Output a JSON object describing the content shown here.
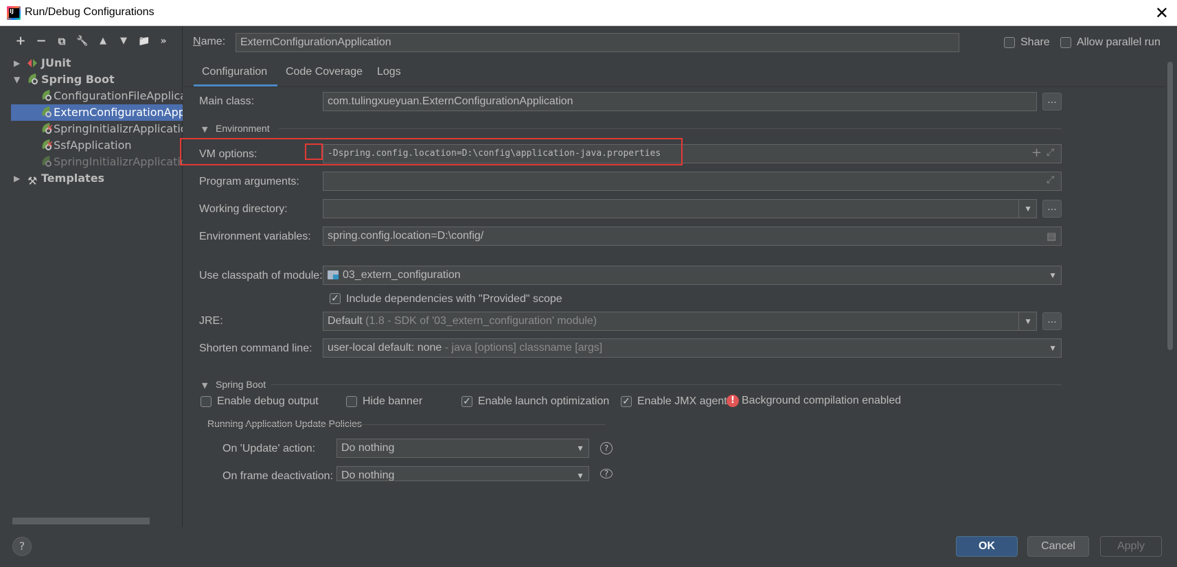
{
  "window": {
    "title": "Run/Debug Configurations"
  },
  "toolbar": {
    "add": "+",
    "remove": "−",
    "copy": "⧉",
    "edit": "🔧",
    "up": "▲",
    "down": "▼",
    "folder": "📁",
    "more": "»"
  },
  "tree": {
    "junit": "JUnit",
    "spring_boot": "Spring Boot",
    "items": [
      "ConfigurationFileApplica",
      "ExternConfigurationAppl",
      "SpringInitializrApplicatio",
      "SsfApplication",
      "SpringInitializrApplicatio"
    ],
    "templates": "Templates"
  },
  "header": {
    "name_label": "Name:",
    "name_value": "ExternConfigurationApplication",
    "share_label": "Share",
    "parallel_label": "Allow parallel run"
  },
  "tabs": [
    "Configuration",
    "Code Coverage",
    "Logs"
  ],
  "form": {
    "main_class_label": "Main class:",
    "main_class_value": "com.tulingxueyuan.ExternConfigurationApplication",
    "environment_section": "Environment",
    "vm_options_label": "VM options:",
    "vm_options_value": "-Dspring.config.location=D:\\config\\application-java.properties",
    "program_args_label": "Program arguments:",
    "working_dir_label": "Working directory:",
    "env_vars_label": "Environment variables:",
    "env_vars_value": "spring.config.location=D:\\config/",
    "classpath_label": "Use classpath of module:",
    "classpath_value": "03_extern_configuration",
    "include_deps_label": "Include dependencies with \"Provided\" scope",
    "jre_label": "JRE:",
    "jre_value_main": "Default",
    "jre_value_detail": "(1.8 - SDK of '03_extern_configuration' module)",
    "shorten_label": "Shorten command line:",
    "shorten_value_main": "user-local default: none",
    "shorten_value_detail": "- java [options] classname [args]",
    "dots": "..."
  },
  "spring_boot": {
    "section": "Spring Boot",
    "debug_output": "Enable debug output",
    "hide_banner": "Hide banner",
    "launch_opt": "Enable launch optimization",
    "jmx_agent": "Enable JMX agent",
    "bg_compile": "Background compilation enabled",
    "policies_title": "Running Application Update Policies",
    "on_update_label": "On 'Update' action:",
    "on_update_value": "Do nothing",
    "on_frame_label": "On frame deactivation:",
    "on_frame_value": "Do nothing"
  },
  "buttons": {
    "ok": "OK",
    "cancel": "Cancel",
    "apply": "Apply",
    "help": "?"
  }
}
